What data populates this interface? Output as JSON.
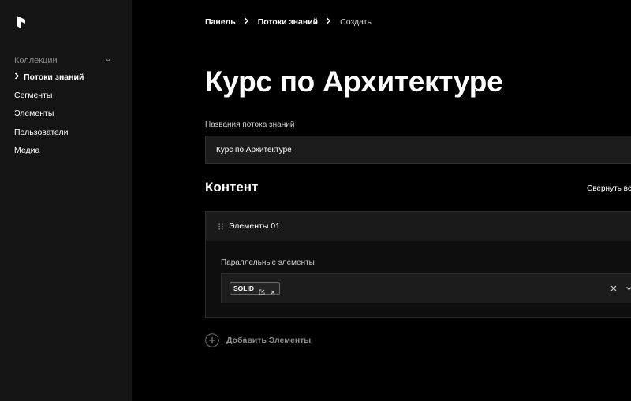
{
  "sidebar": {
    "group_label": "Коллекции",
    "items": [
      {
        "label": "Потоки знаний",
        "active": true
      },
      {
        "label": "Сегменты",
        "active": false
      },
      {
        "label": "Элементы",
        "active": false
      },
      {
        "label": "Пользователи",
        "active": false
      },
      {
        "label": "Медиа",
        "active": false
      }
    ]
  },
  "breadcrumb": [
    "Панель",
    "Потоки знаний",
    "Создать"
  ],
  "page_title": "Курс по Архитектуре",
  "name_field": {
    "label": "Названия потока знаний",
    "value": "Курс по Архитектуре"
  },
  "content_section": {
    "title": "Контент",
    "collapse_all_label": "Свернуть вс"
  },
  "block": {
    "title": "Элементы 01",
    "relationship_label": "Параллельные элементы",
    "selected": [
      {
        "label": "SOLID"
      }
    ]
  },
  "add_button_label": "Добавить Элементы",
  "colors": {
    "sidebar_bg": "#141414",
    "main_bg": "#000000",
    "input_bg": "#1c1c1c",
    "muted_text": "#8c8c8c"
  }
}
